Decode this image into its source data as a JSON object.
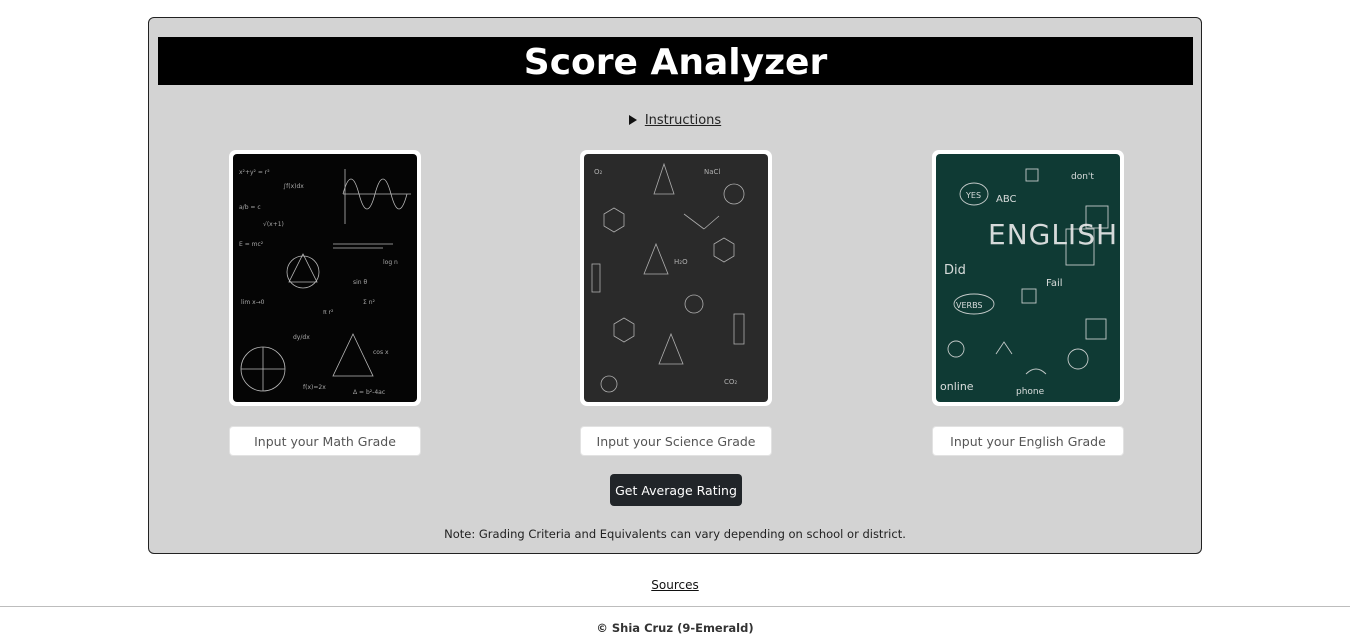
{
  "header": {
    "title": "Score Analyzer"
  },
  "instructions": {
    "label": "Instructions"
  },
  "subjects": [
    {
      "name": "Math",
      "icon": "math-chalkboard-image",
      "bg": "#050505",
      "placeholder": "Input your Math Grade"
    },
    {
      "name": "Science",
      "icon": "science-chalkboard-image",
      "bg": "#2a2a2a",
      "placeholder": "Input your Science Grade"
    },
    {
      "name": "English",
      "icon": "english-chalkboard-image",
      "bg": "#0f3a34",
      "placeholder": "Input your English Grade"
    }
  ],
  "actions": {
    "average_label": "Get Average Rating"
  },
  "note": "Note: Grading Criteria and Equivalents can vary depending on school or district.",
  "links": {
    "sources": "Sources"
  },
  "footer": {
    "copyright": "© Shia Cruz (9-Emerald)"
  },
  "colors": {
    "panel": "#d3d3d3",
    "title_bar": "#000000",
    "button": "#212529"
  }
}
